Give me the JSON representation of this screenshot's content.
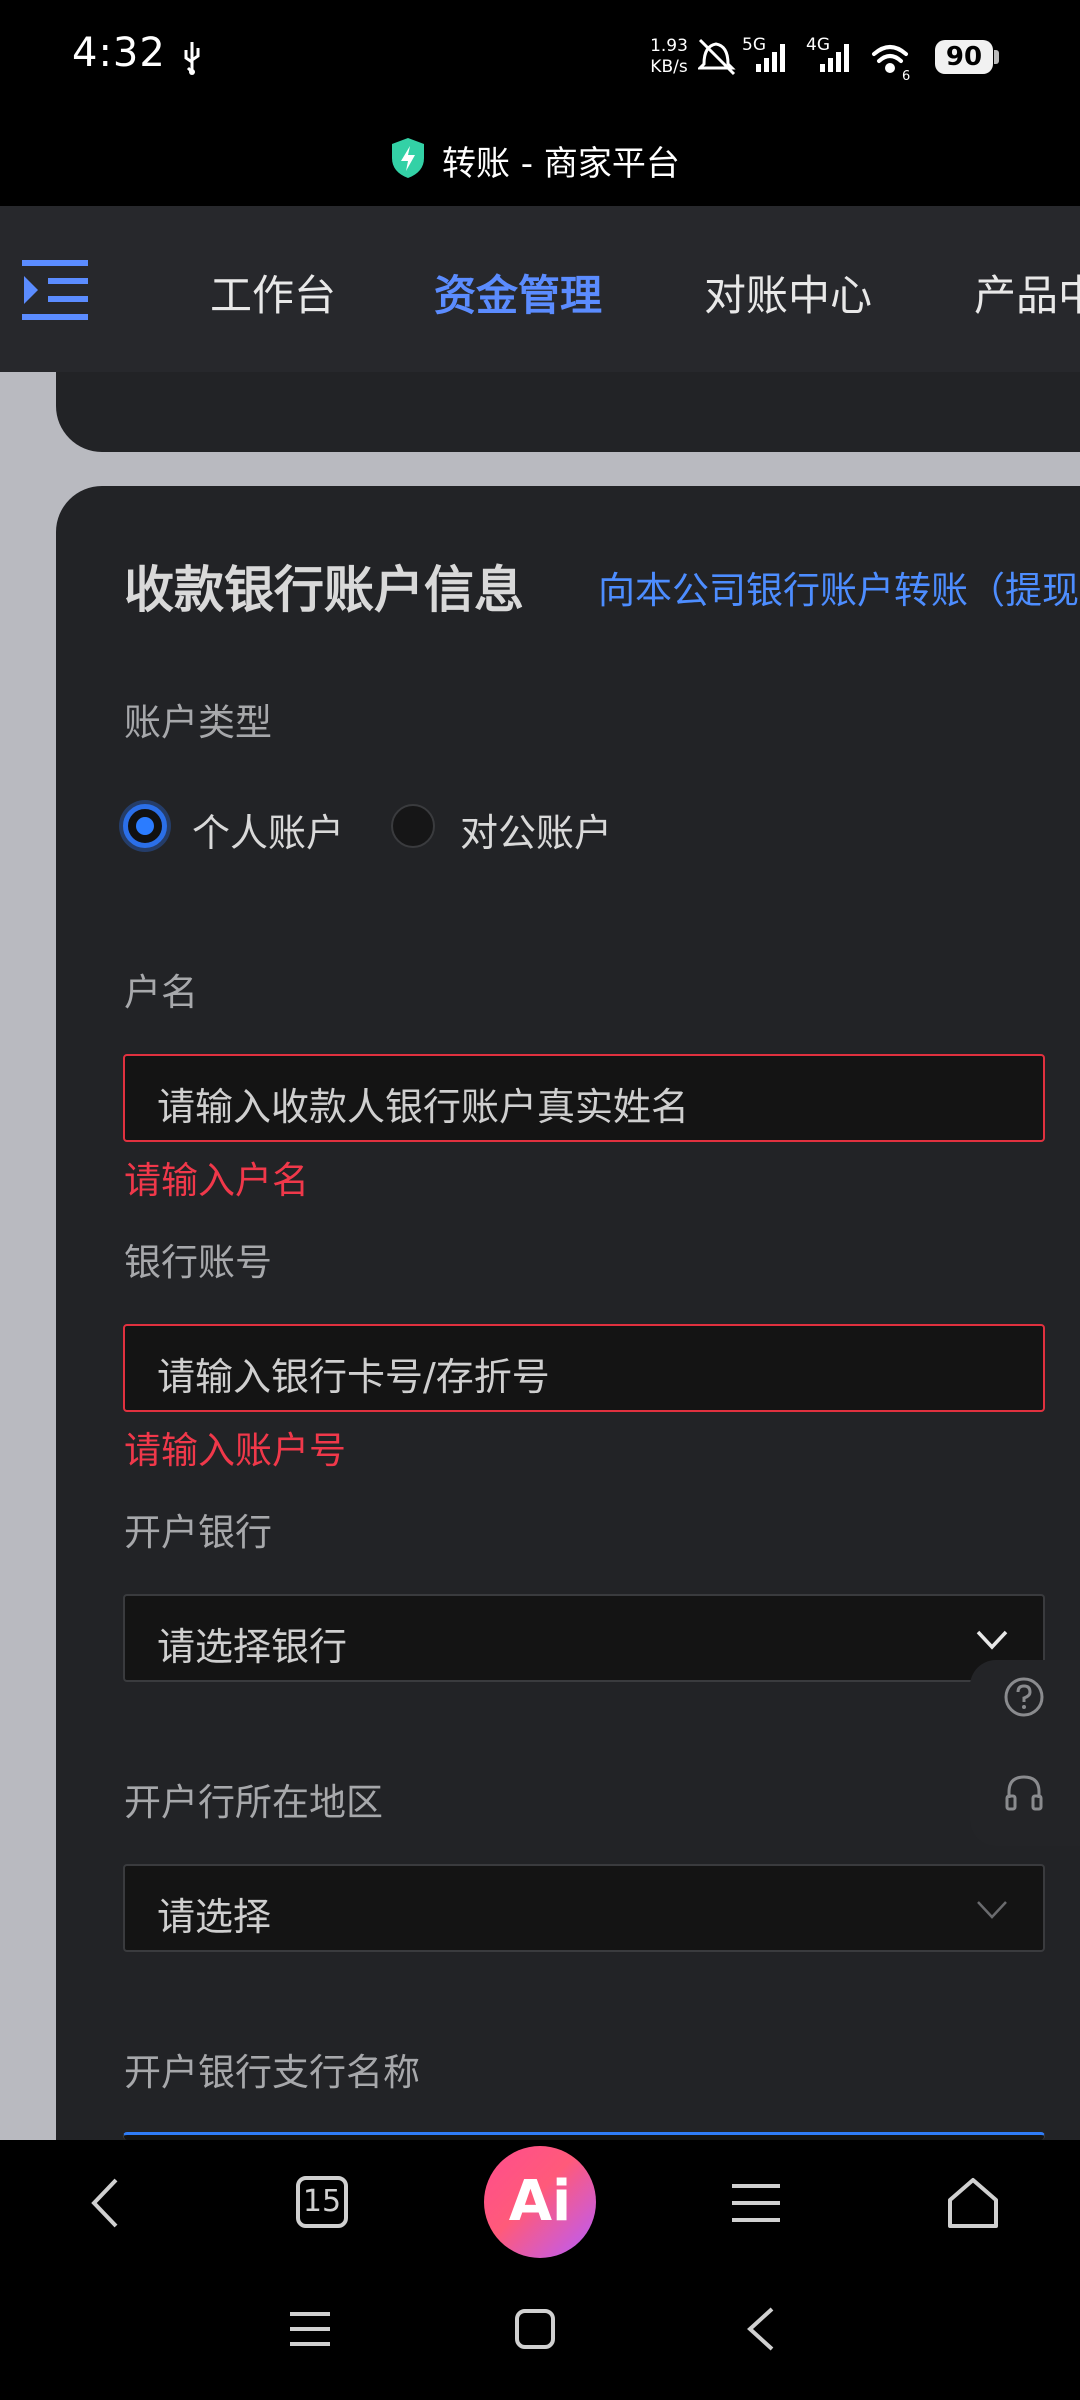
{
  "status_bar": {
    "time": "4:32",
    "net_speed_value": "1.93",
    "net_speed_unit": "KB/s",
    "signal_5g": "5G",
    "signal_4g": "4G",
    "wifi_sub": "6",
    "battery": "90"
  },
  "browser": {
    "page_title": "转账 - 商家平台",
    "tab_count": "15",
    "ai_label": "Ai"
  },
  "nav": {
    "items": [
      {
        "label": "工作台"
      },
      {
        "label": "资金管理"
      },
      {
        "label": "对账中心"
      },
      {
        "label": "产品中心"
      }
    ],
    "active": "资金管理"
  },
  "form": {
    "section_title": "收款银行账户信息",
    "transfer_link": "向本公司银行账户转账（提现",
    "account_type_label": "账户类型",
    "account_type_options": [
      "个人账户",
      "对公账户"
    ],
    "account_type_selected": "个人账户",
    "account_name_label": "户名",
    "account_name_placeholder": "请输入收款人银行账户真实姓名",
    "account_name_error": "请输入户名",
    "account_number_label": "银行账号",
    "account_number_placeholder": "请输入银行卡号/存折号",
    "account_number_error": "请输入账户号",
    "bank_label": "开户银行",
    "bank_placeholder": "请选择银行",
    "region_label": "开户行所在地区",
    "region_placeholder": "请选择",
    "branch_label": "开户银行支行名称"
  },
  "colors": {
    "accent": "#5b8cff",
    "error": "#f0384a",
    "card_bg": "#222326",
    "link": "#4d8dff"
  },
  "icons": {
    "menu": "menu-indent-icon",
    "help": "question-circle-icon",
    "support": "headset-icon"
  }
}
